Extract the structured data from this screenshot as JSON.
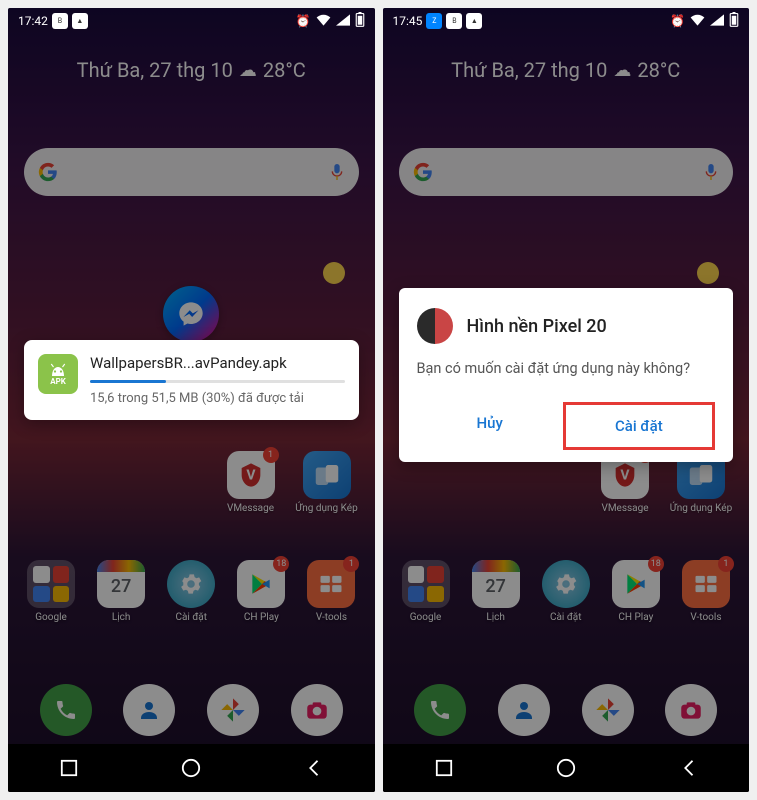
{
  "screens": {
    "left": {
      "time": "17:42",
      "date": "Thứ Ba, 27 thg 10",
      "temp": "28°C",
      "download": {
        "filename": "WallpapersBR...avPandey.apk",
        "status": "15,6 trong 51,5 MB (30%) đã được tải",
        "apk_label": "APK",
        "progress_pct": 30
      }
    },
    "right": {
      "time": "17:45",
      "date": "Thứ Ba, 27 thg 10",
      "temp": "28°C",
      "dialog": {
        "title": "Hình nền Pixel 20",
        "message": "Bạn có muốn cài đặt ứng dụng này không?",
        "cancel": "Hủy",
        "install": "Cài đặt"
      }
    }
  },
  "apps": {
    "vmessage": "VMessage",
    "ungdungkep": "Ứng dụng Kép",
    "google": "Google",
    "lich": "Lịch",
    "caidat": "Cài đặt",
    "chplay": "CH Play",
    "vtools": "V-tools",
    "calendar_day": "27"
  },
  "badges": {
    "vmessage": "1",
    "vtools": "1",
    "chplay": "18"
  }
}
